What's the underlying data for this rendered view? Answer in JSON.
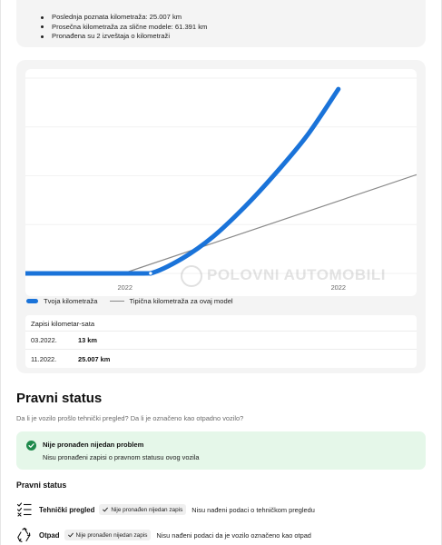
{
  "summary": {
    "items": [
      "Poslednja poznata kilometraža: 25.007 km",
      "Prosečna kilometraža za slične modele: 61.391 km",
      "Pronađena su 2 izveštaja o kilometraži"
    ]
  },
  "chart_data": {
    "type": "line",
    "x_ticks": [
      "2022",
      "2022"
    ],
    "series": [
      {
        "name": "Tvoja kilometraža",
        "color": "#1a73d9",
        "points": [
          {
            "x": 0.0,
            "y": 0
          },
          {
            "x": 0.25,
            "y": 0
          },
          {
            "x": 0.32,
            "y": 13
          },
          {
            "x": 0.4,
            "y": 2000
          },
          {
            "x": 0.48,
            "y": 5000
          },
          {
            "x": 0.56,
            "y": 9000
          },
          {
            "x": 0.64,
            "y": 13600
          },
          {
            "x": 0.72,
            "y": 18700
          },
          {
            "x": 0.8,
            "y": 25007
          }
        ]
      },
      {
        "name": "Tipična kilometraža za ovaj model",
        "color": "#8a8a8a",
        "points": [
          {
            "x": 0.25,
            "y": 0
          },
          {
            "x": 1.0,
            "y": 13400
          }
        ]
      }
    ],
    "ylim": [
      0,
      26500
    ],
    "xlim": [
      0,
      1
    ],
    "watermark": "POLOVNI AUTOMOBILI",
    "grid": true
  },
  "legend": {
    "user_label": "Tvoja kilometraža",
    "typical_label": "Tipična kilometraža za ovaj model"
  },
  "records": {
    "title": "Zapisi kilometar-sata",
    "rows": [
      {
        "date": "03.2022.",
        "value": "13 km"
      },
      {
        "date": "11.2022.",
        "value": "25.007 km"
      }
    ]
  },
  "legal": {
    "heading": "Pravni status",
    "subtitle": "Da li je vozilo prošlo tehnički pregled? Da li je označeno kao otpadno vozilo?",
    "status_title": "Nije pronađen nijedan problem",
    "status_desc": "Nisu pronađeni zapisi o pravnom statusu ovog vozila",
    "section_title": "Pravni status",
    "checks": [
      {
        "icon": "checklist-icon",
        "label": "Tehnički pregled",
        "badge": "Nije pronađen nijedan zapis",
        "text": "Nisu nađeni podaci o tehničkom pregledu"
      },
      {
        "icon": "recycle-icon",
        "label": "Otpad",
        "badge": "Nije pronađen nijedan zapis",
        "text": "Nisu nađeni podaci da je vozilo označeno kao otpad"
      }
    ]
  },
  "colors": {
    "accent_blue": "#1a73d9",
    "success_green": "#1f8a4c",
    "success_bg": "#e5f7e9"
  }
}
